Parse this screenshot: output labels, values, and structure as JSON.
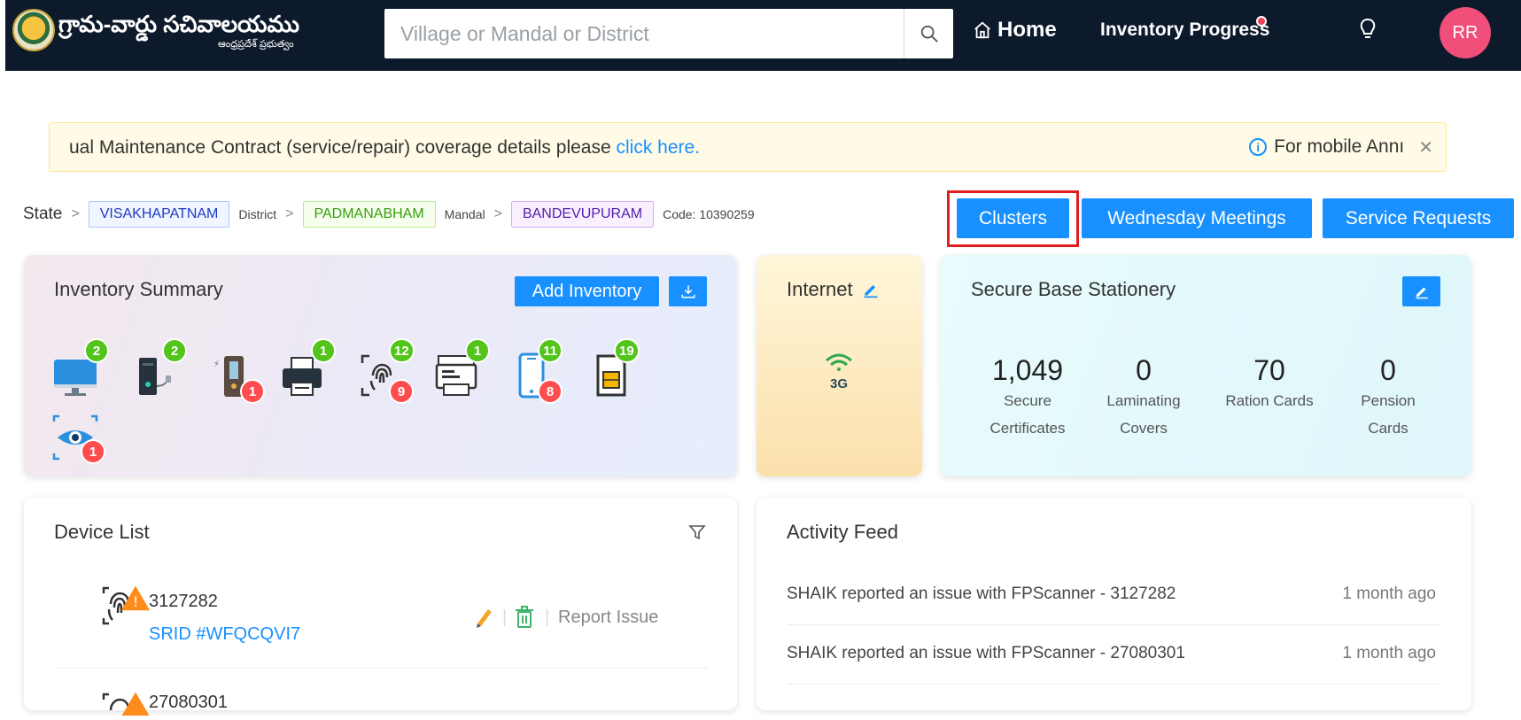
{
  "header": {
    "brand_title": "గ్రామ-వార్డు సచివాలయము",
    "brand_subtitle": "ఆంధ్రప్రదేశ్ ప్రభుత్వం",
    "search_placeholder": "Village or Mandal or District",
    "nav_home": "Home",
    "nav_inventory_progress": "Inventory Progress",
    "avatar_initials": "RR"
  },
  "banner": {
    "text": "ual Maintenance Contract (service/repair) coverage details please",
    "link": "click here.",
    "right_text": "For mobile Annı"
  },
  "breadcrumb": {
    "state_label": "State",
    "district_value": "VISAKHAPATNAM",
    "district_label": "District",
    "mandal_value": "PADMANABHAM",
    "mandal_label": "Mandal",
    "village_value": "BANDEVUPURAM",
    "code_text": "Code: 10390259"
  },
  "actions": {
    "clusters": "Clusters",
    "wednesday_meetings": "Wednesday Meetings",
    "service_requests": "Service Requests"
  },
  "inventory_summary": {
    "title": "Inventory Summary",
    "add_inventory": "Add Inventory",
    "devices": [
      {
        "icon": "monitor-icon",
        "ok": "2"
      },
      {
        "icon": "cpu-tower-icon",
        "ok": "2"
      },
      {
        "icon": "ups-icon",
        "faulty": "1"
      },
      {
        "icon": "printer-icon",
        "ok": "1"
      },
      {
        "icon": "fingerprint-scanner-icon",
        "ok": "12",
        "faulty": "9"
      },
      {
        "icon": "multifunction-printer-icon",
        "ok": "1"
      },
      {
        "icon": "mobile-phone-icon",
        "ok": "11",
        "faulty": "8"
      },
      {
        "icon": "sim-card-icon",
        "ok": "19"
      },
      {
        "icon": "iris-scanner-icon",
        "faulty": "1"
      }
    ],
    "colors": {
      "ok": "#52c41a",
      "faulty": "#ff4d4f"
    }
  },
  "internet": {
    "title": "Internet",
    "network_label": "3G"
  },
  "stationery": {
    "title": "Secure Base Stationery",
    "items": [
      {
        "value": "1,049",
        "label_line1": "Secure",
        "label_line2": "Certificates"
      },
      {
        "value": "0",
        "label_line1": "Laminating",
        "label_line2": "Covers"
      },
      {
        "value": "70",
        "label_line1": "Ration Cards",
        "label_line2": ""
      },
      {
        "value": "0",
        "label_line1": "Pension",
        "label_line2": "Cards"
      }
    ]
  },
  "device_list": {
    "title": "Device List",
    "items": [
      {
        "id": "3127282",
        "srid": "SRID #WFQCQVI7",
        "action": "Report Issue"
      },
      {
        "id": "27080301"
      }
    ]
  },
  "activity_feed": {
    "title": "Activity Feed",
    "items": [
      {
        "text": "SHAIK reported an issue with FPScanner - 3127282",
        "time": "1 month ago"
      },
      {
        "text": "SHAIK reported an issue with FPScanner - 27080301",
        "time": "1 month ago"
      }
    ]
  },
  "theme": {
    "primary": "#1890ff",
    "topbar": "#0d1a2c",
    "avatar": "#f04f7a",
    "highlight": "#e02020"
  }
}
